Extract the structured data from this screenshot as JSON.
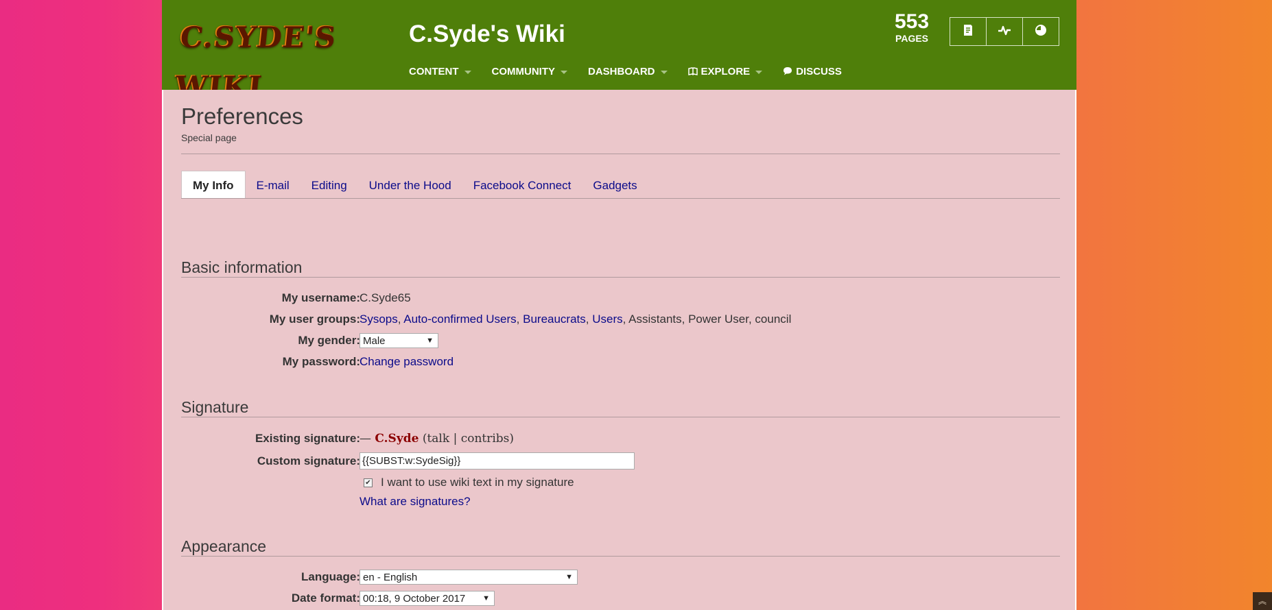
{
  "header": {
    "logo_text": "C.SYDE'S WIKI",
    "wiki_title": "C.Syde's Wiki",
    "pages_count": "553",
    "pages_label": "PAGES",
    "nav": [
      {
        "label": "CONTENT"
      },
      {
        "label": "COMMUNITY"
      },
      {
        "label": "DASHBOARD"
      },
      {
        "label": "EXPLORE"
      },
      {
        "label": "DISCUSS"
      }
    ],
    "buttons": [
      "add-page-icon",
      "activity-icon",
      "discussions-icon"
    ]
  },
  "page": {
    "title": "Preferences",
    "subtitle": "Special page"
  },
  "tabs": [
    {
      "label": "My Info",
      "active": true
    },
    {
      "label": "E-mail"
    },
    {
      "label": "Editing"
    },
    {
      "label": "Under the Hood"
    },
    {
      "label": "Facebook Connect"
    },
    {
      "label": "Gadgets"
    }
  ],
  "basic": {
    "heading": "Basic information",
    "username_label": "My username:",
    "username": "C.Syde65",
    "groups_label": "My user groups:",
    "group_links": [
      "Sysops",
      "Auto-confirmed Users",
      "Bureaucrats",
      "Users"
    ],
    "group_plain": [
      "Assistants",
      "Power User",
      "council"
    ],
    "gender_label": "My gender:",
    "gender_value": "Male",
    "password_label": "My password:",
    "password_link": "Change password"
  },
  "signature": {
    "heading": "Signature",
    "existing_label": "Existing signature:",
    "existing_dash": "—",
    "existing_name": "C.Syde",
    "existing_rest": "(talk | contribs)",
    "custom_label": "Custom signature:",
    "custom_value": "{{SUBST:w:SydeSig}}",
    "wikitext_checkbox_label": "I want to use wiki text in my signature",
    "wikitext_checked": true,
    "help_link": "What are signatures?"
  },
  "appearance": {
    "heading": "Appearance",
    "language_label": "Language:",
    "language_value": "en - English",
    "date_label": "Date format:",
    "date_value": "00:18, 9 October 2017"
  },
  "colors": {
    "header_bg": "#4f7f0a",
    "page_bg": "#ebc7cb",
    "link": "#0b0b8a"
  }
}
